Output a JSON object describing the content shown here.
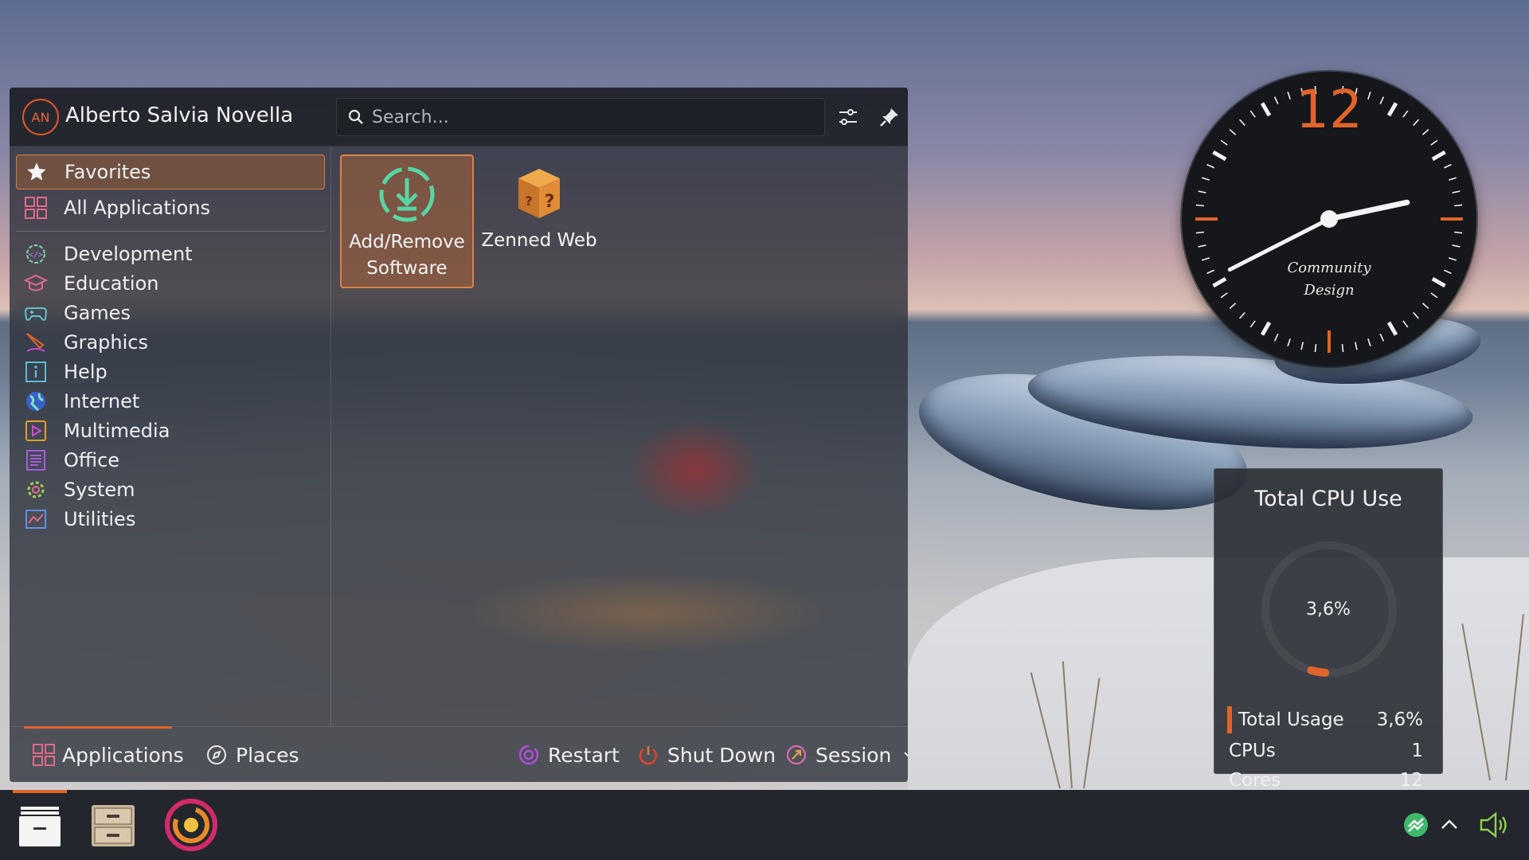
{
  "launcher": {
    "user": {
      "initials": "AN",
      "name": "Alberto Salvia Novella"
    },
    "search": {
      "placeholder": "Search..."
    },
    "header_buttons": [
      {
        "icon": "configure-icon"
      },
      {
        "icon": "pin-icon"
      }
    ],
    "sidebar": {
      "items": [
        {
          "label": "Favorites",
          "icon": "star-icon",
          "active": true
        },
        {
          "label": "All Applications",
          "icon": "grid-icon"
        },
        {
          "label": "Development",
          "icon": "development-icon"
        },
        {
          "label": "Education",
          "icon": "education-icon"
        },
        {
          "label": "Games",
          "icon": "gamepad-icon"
        },
        {
          "label": "Graphics",
          "icon": "graphics-icon"
        },
        {
          "label": "Help",
          "icon": "help-icon"
        },
        {
          "label": "Internet",
          "icon": "globe-icon"
        },
        {
          "label": "Multimedia",
          "icon": "multimedia-icon"
        },
        {
          "label": "Office",
          "icon": "office-icon"
        },
        {
          "label": "System",
          "icon": "system-gear-icon"
        },
        {
          "label": "Utilities",
          "icon": "utilities-icon"
        }
      ]
    },
    "apps": [
      {
        "label_line1": "Add/Remove",
        "label_line2": "Software",
        "icon": "software-install-icon",
        "selected": true
      },
      {
        "label_line1": "Zenned Web",
        "label_line2": "",
        "icon": "question-box-icon"
      }
    ],
    "footer": {
      "tabs": [
        {
          "label": "Applications",
          "icon": "grid-icon",
          "active": true
        },
        {
          "label": "Places",
          "icon": "compass-icon"
        }
      ],
      "actions": [
        {
          "label": "Restart",
          "icon": "restart-icon"
        },
        {
          "label": "Shut Down",
          "icon": "power-icon"
        },
        {
          "label": "Session",
          "icon": "session-icon"
        }
      ]
    }
  },
  "clock": {
    "numeral": "12",
    "caption_line1": "Community",
    "caption_line2": "Design",
    "hour_hand_angle_deg": 78,
    "minute_hand_angle_deg": 243,
    "accent": "#e0642a"
  },
  "cpu_widget": {
    "title": "Total CPU Use",
    "value_text": "3,6%",
    "value_percent": 3.6,
    "rows": [
      {
        "label": "Total Usage",
        "value": "3,6%"
      },
      {
        "label": "CPUs",
        "value": "1"
      },
      {
        "label": "Cores",
        "value": "12"
      }
    ]
  },
  "taskbar": {
    "tasks": [
      {
        "icon": "application-menu-icon",
        "active": true
      },
      {
        "icon": "file-manager-icon"
      },
      {
        "icon": "browser-icon"
      }
    ],
    "tray": [
      {
        "icon": "network-icon"
      },
      {
        "icon": "expand-tray-icon"
      },
      {
        "icon": "volume-icon"
      }
    ]
  },
  "colors": {
    "accent": "#e0642a",
    "panel": "#23262c",
    "selection": "#d9834c"
  }
}
